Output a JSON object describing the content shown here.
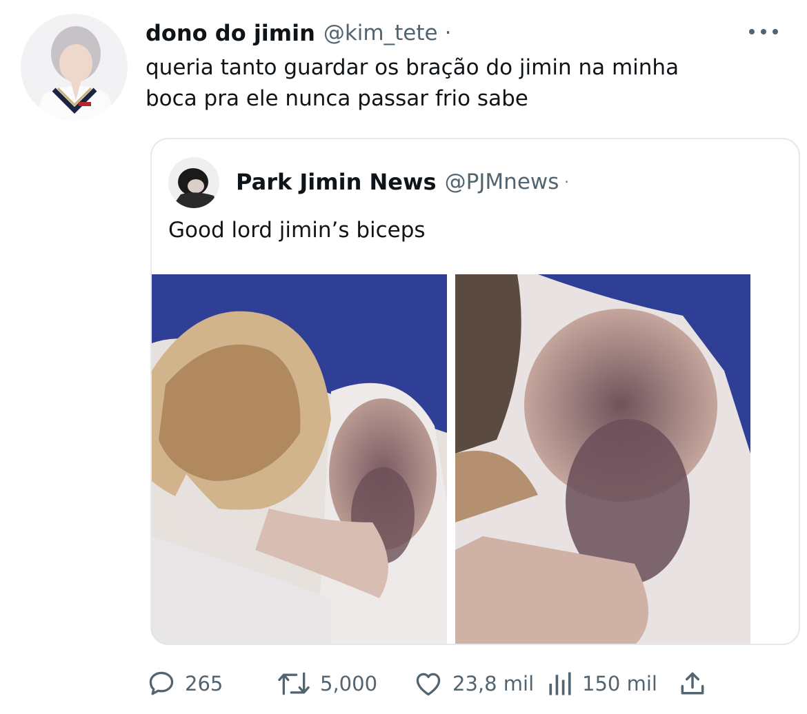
{
  "tweet": {
    "display_name": "dono do jimin",
    "handle": "@kim_tete",
    "separator": "·",
    "text": "queria tanto guardar os bração do jimin na minha\nboca pra ele nunca passar frio sabe",
    "more_icon": "more-horizontal-icon"
  },
  "quoted_tweet": {
    "display_name": "Park Jimin News",
    "handle": "@PJMnews",
    "separator": "·",
    "text": "Good lord jimin’s biceps",
    "media_count": 2
  },
  "actions": {
    "replies": {
      "icon": "reply-icon",
      "count": "265"
    },
    "retweets": {
      "icon": "retweet-icon",
      "count": "5,000"
    },
    "likes": {
      "icon": "heart-icon",
      "count": "23,8 mil"
    },
    "views": {
      "icon": "analytics-icon",
      "count": "150 mil"
    },
    "share": {
      "icon": "share-icon"
    }
  },
  "colors": {
    "text": "#0f1419",
    "secondary": "#536471",
    "border": "#e3e8ec",
    "photo_background": "#2f3f95"
  }
}
